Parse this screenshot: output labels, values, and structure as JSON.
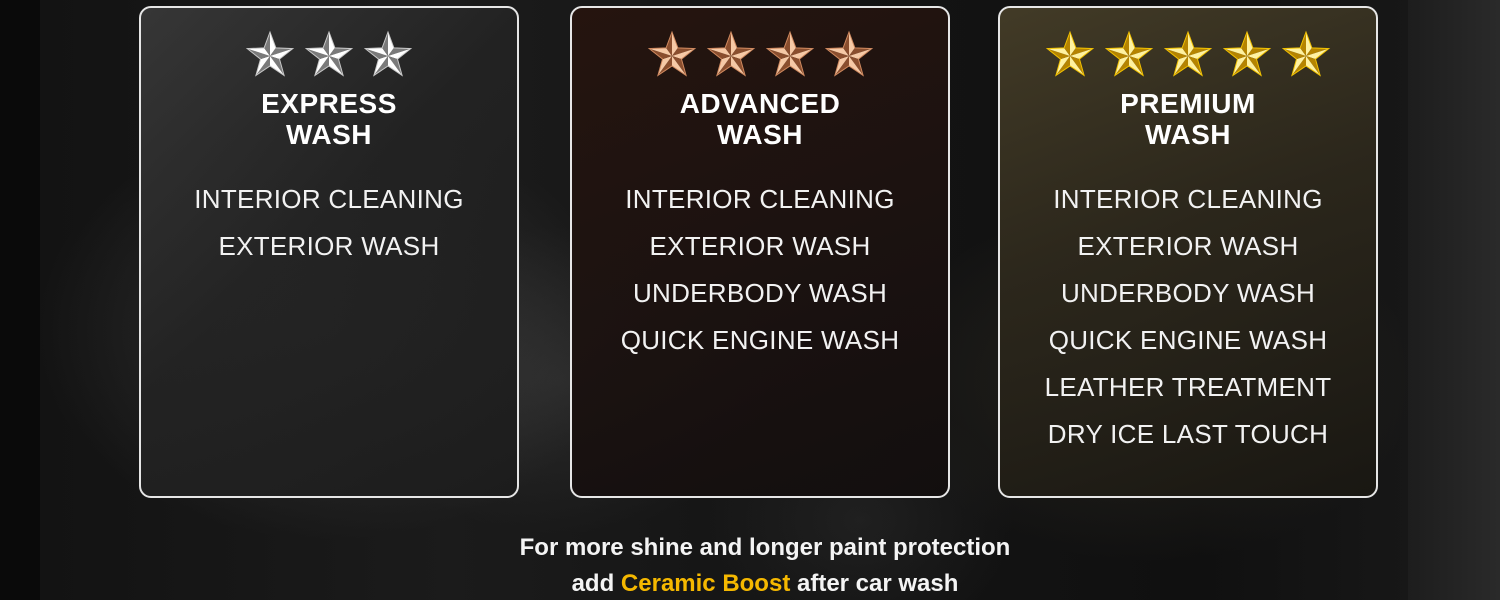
{
  "colors": {
    "silver_star": "#cfcfcf",
    "bronze_star": "#d08a60",
    "gold_star": "#f2c200",
    "accent": "#f5b800",
    "card_border": "#e6e6e6",
    "text": "#ffffff"
  },
  "plans": [
    {
      "rating": 3,
      "star_style": "silver",
      "title_line1": "EXPRESS",
      "title_line2": "WASH",
      "features": [
        "INTERIOR CLEANING",
        "EXTERIOR WASH"
      ]
    },
    {
      "rating": 4,
      "star_style": "bronze",
      "title_line1": "ADVANCED",
      "title_line2": "WASH",
      "features": [
        "INTERIOR CLEANING",
        "EXTERIOR WASH",
        "UNDERBODY WASH",
        "QUICK ENGINE WASH"
      ]
    },
    {
      "rating": 5,
      "star_style": "gold",
      "title_line1": "PREMIUM",
      "title_line2": "WASH",
      "features": [
        "INTERIOR CLEANING",
        "EXTERIOR WASH",
        "UNDERBODY WASH",
        "QUICK ENGINE WASH",
        "LEATHER TREATMENT",
        "DRY ICE LAST TOUCH"
      ]
    }
  ],
  "footer": {
    "line1": "For more shine and longer paint protection",
    "line2_prefix": "add ",
    "line2_highlight": "Ceramic Boost",
    "line2_suffix": " after car wash"
  },
  "icons": {
    "rating_star": "star-icon"
  }
}
